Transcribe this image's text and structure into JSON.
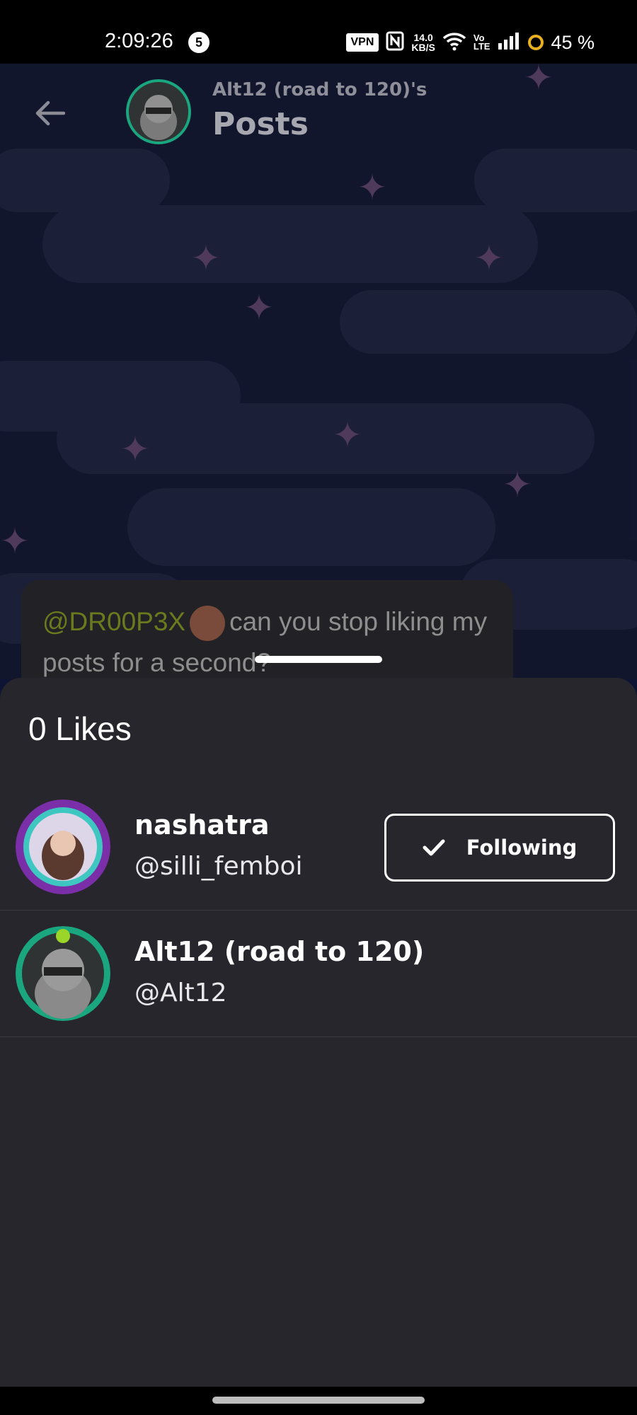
{
  "status_bar": {
    "time": "2:09:26",
    "notification_count": "5",
    "vpn": "VPN",
    "net_speed_value": "14.0",
    "net_speed_unit": "KB/S",
    "volte_top": "Vo",
    "volte_bottom": "LTE",
    "battery": "45 %"
  },
  "header": {
    "subtitle": "Alt12 (road to 120)'s",
    "title": "Posts"
  },
  "post": {
    "mention": "@DR00P3X",
    "text": "can you stop liking my posts for a second?"
  },
  "likes_sheet": {
    "title": "0 Likes",
    "users": [
      {
        "name": "nashatra",
        "handle": "@silli_femboi",
        "follow_label": "Following"
      },
      {
        "name": "Alt12 (road to 120)",
        "handle": "@Alt12"
      }
    ]
  },
  "colors": {
    "sheet_bg": "#27262d",
    "accent_green": "#1aa67e",
    "mention_color": "#6c7a1e"
  },
  "icons": {
    "back": "arrow-left-icon",
    "check": "check-icon"
  }
}
